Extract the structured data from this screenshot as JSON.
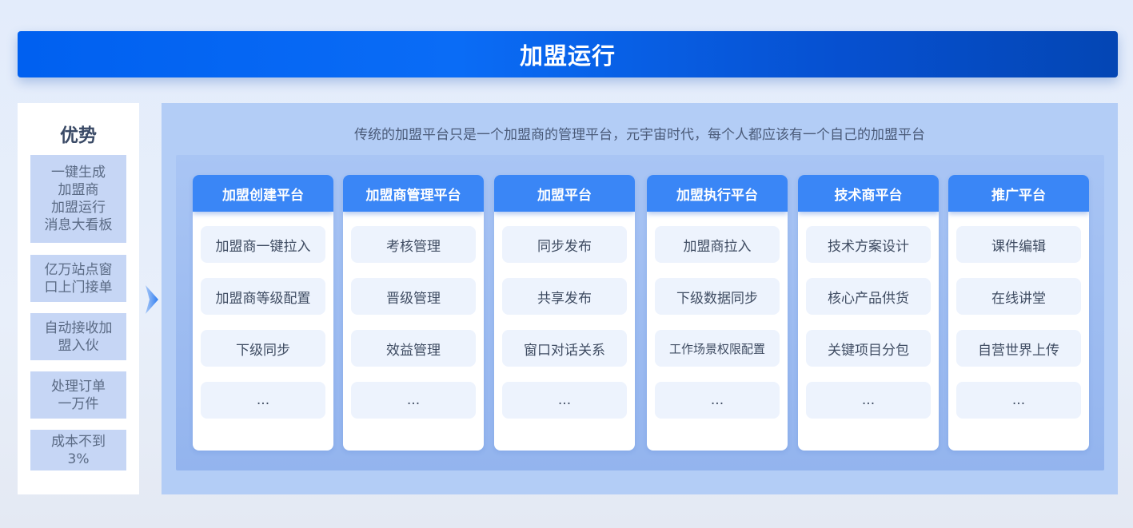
{
  "header": {
    "title": "加盟运行"
  },
  "advantages": {
    "title": "优势",
    "items": [
      "一键生成\n加盟商\n加盟运行\n消息大看板",
      "亿万站点窗\n口上门接单",
      "自动接收加\n盟入伙",
      "处理订单\n一万件",
      "成本不到\n3%"
    ]
  },
  "main": {
    "subtitle": "传统的加盟平台只是一个加盟商的管理平台，元宇宙时代，每个人都应该有一个自己的加盟平台",
    "columns": [
      {
        "title": "加盟创建平台",
        "items": [
          "加盟商一键拉入",
          "加盟商等级配置",
          "下级同步",
          "..."
        ]
      },
      {
        "title": "加盟商管理平台",
        "items": [
          "考核管理",
          "晋级管理",
          "效益管理",
          "..."
        ]
      },
      {
        "title": "加盟平台",
        "items": [
          "同步发布",
          "共享发布",
          "窗口对话关系",
          "..."
        ]
      },
      {
        "title": "加盟执行平台",
        "items": [
          "加盟商拉入",
          "下级数据同步",
          "工作场景权限配置",
          "..."
        ]
      },
      {
        "title": "技术商平台",
        "items": [
          "技术方案设计",
          "核心产品供货",
          "关键项目分包",
          "..."
        ]
      },
      {
        "title": "推广平台",
        "items": [
          "课件编辑",
          "在线讲堂",
          "自营世界上传",
          "..."
        ]
      }
    ]
  },
  "colors": {
    "header": "#0a6cf6",
    "column_header": "#3a86f6",
    "panel": "#b3cdf6",
    "advantage_item": "#c6d6f5"
  }
}
